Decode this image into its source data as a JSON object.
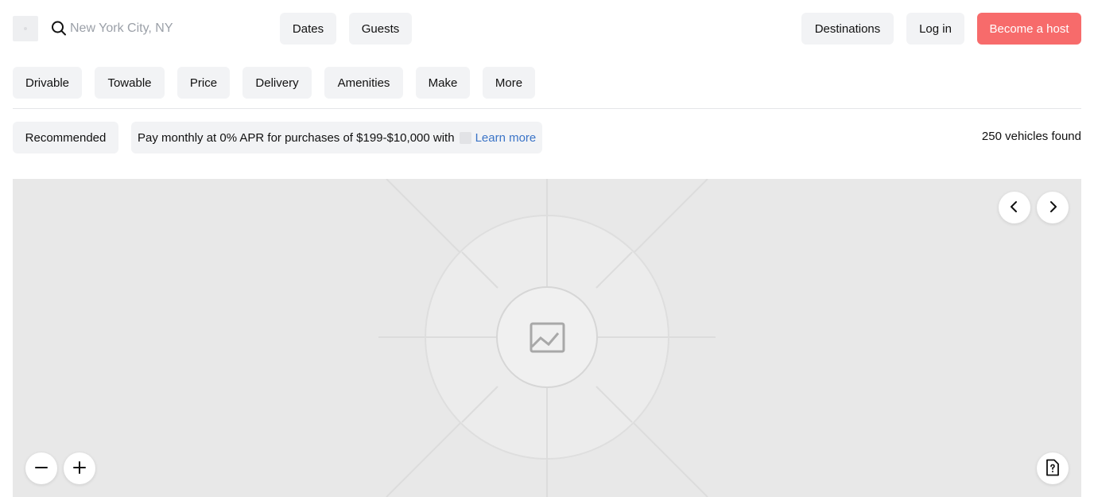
{
  "header": {
    "search": {
      "placeholder": "New York City, NY",
      "value": "",
      "icon": "search-icon"
    },
    "dates_label": "Dates",
    "guests_label": "Guests",
    "destinations_label": "Destinations",
    "login_label": "Log in",
    "host_label": "Become a host"
  },
  "filters": [
    {
      "label": "Drivable"
    },
    {
      "label": "Towable"
    },
    {
      "label": "Price"
    },
    {
      "label": "Delivery"
    },
    {
      "label": "Amenities"
    },
    {
      "label": "Make"
    },
    {
      "label": "More"
    }
  ],
  "sort": {
    "label": "Recommended"
  },
  "promo": {
    "text": "Pay monthly at 0% APR for purchases of $199-$10,000 with",
    "link_label": "Learn more"
  },
  "results": {
    "count_text": "250 vehicles found"
  },
  "map": {
    "controls": {
      "prev_icon": "chevron-left-icon",
      "next_icon": "chevron-right-icon",
      "zoom_out_icon": "minus-icon",
      "zoom_in_icon": "plus-icon",
      "help_icon": "document-question-icon"
    },
    "placeholder_icon": "image-placeholder-icon"
  },
  "colors": {
    "accent": "#f76b6b",
    "pill_bg": "#f2f3f5",
    "link": "#3b74c7",
    "map_bg": "#e8e8e8"
  }
}
